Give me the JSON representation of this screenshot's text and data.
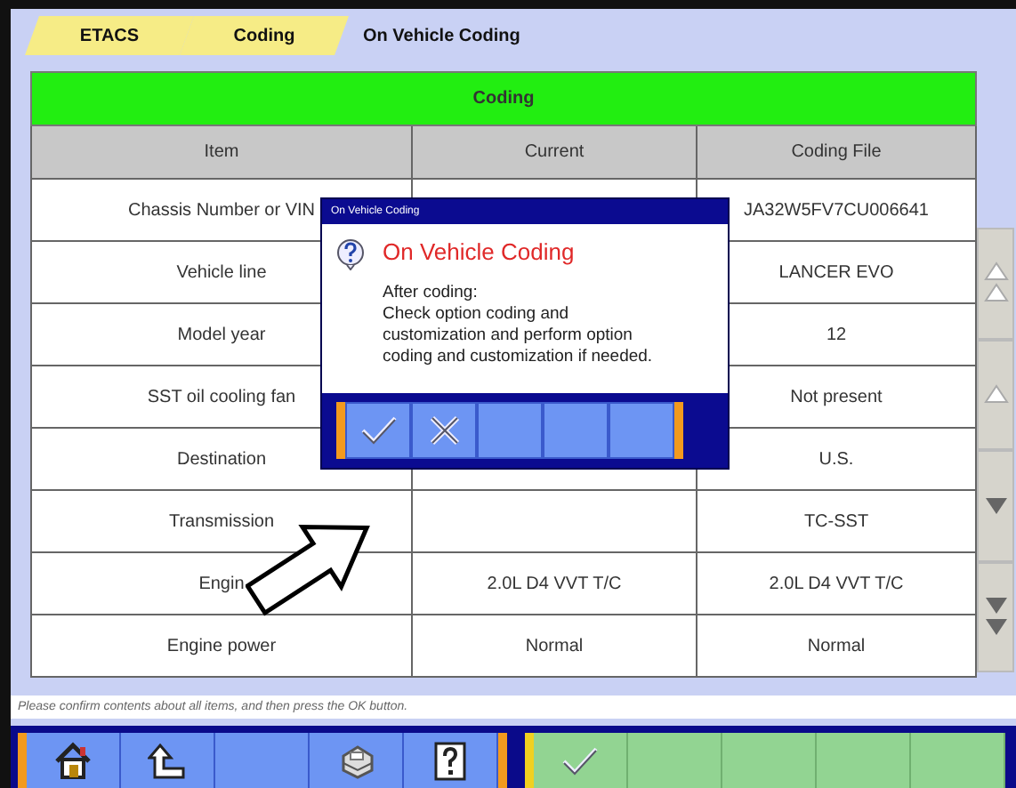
{
  "tabs": [
    {
      "label": "ETACS",
      "selected": false
    },
    {
      "label": "Coding",
      "selected": false
    },
    {
      "label": "On Vehicle Coding",
      "selected": true
    }
  ],
  "table": {
    "title": "Coding",
    "columns": [
      "Item",
      "Current",
      "Coding File"
    ],
    "rows": [
      {
        "item": "Chassis Number or VIN",
        "coding_file": "JA32W5FV7CU006641"
      },
      {
        "item": "Vehicle line",
        "coding_file": "LANCER EVO"
      },
      {
        "item": "Model year",
        "coding_file": "12"
      },
      {
        "item": "SST oil cooling fan",
        "coding_file": "Not present"
      },
      {
        "item": "Destination",
        "coding_file": "U.S."
      },
      {
        "item": "Transmission",
        "coding_file": "TC-SST"
      },
      {
        "item": "Engin",
        "current": "2.0L D4 VVT T/C",
        "coding_file": "2.0L D4 VVT T/C"
      },
      {
        "item": "Engine power",
        "current": "Normal",
        "coding_file": "Normal"
      }
    ]
  },
  "scroll_buttons": [
    {
      "kind": "page-up"
    },
    {
      "kind": "up"
    },
    {
      "kind": "down"
    },
    {
      "kind": "page-down"
    }
  ],
  "dialog": {
    "title": "On Vehicle Coding",
    "heading": "On Vehicle Coding",
    "message": [
      "After coding:",
      "Check option coding and customization and perform option coding and customization if needed."
    ],
    "buttons": [
      {
        "kind": "ok"
      },
      {
        "kind": "cancel"
      },
      {
        "kind": "empty"
      },
      {
        "kind": "empty"
      },
      {
        "kind": "empty"
      }
    ]
  },
  "status_bar": "Please confirm contents about all items, and then press the OK button.",
  "toolbar_left": [
    {
      "kind": "home"
    },
    {
      "kind": "back"
    },
    {
      "kind": "empty"
    },
    {
      "kind": "print"
    },
    {
      "kind": "help"
    }
  ],
  "toolbar_right": [
    {
      "kind": "ok"
    },
    {
      "kind": "empty"
    },
    {
      "kind": "empty"
    },
    {
      "kind": "empty"
    },
    {
      "kind": "empty"
    }
  ]
}
